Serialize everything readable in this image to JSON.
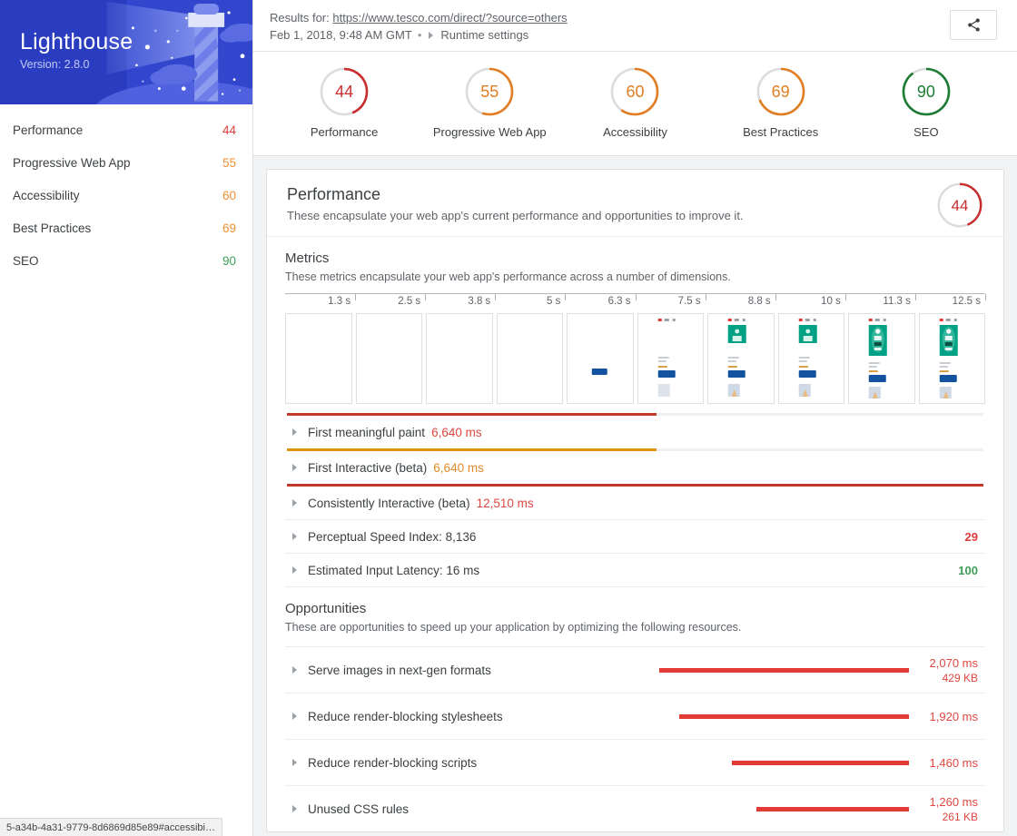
{
  "sidebar": {
    "app_title": "Lighthouse",
    "version_label": "Version: 2.8.0",
    "items": [
      {
        "label": "Performance",
        "score": "44",
        "color": "#df3c3c"
      },
      {
        "label": "Progressive Web App",
        "score": "55",
        "color": "#ef8f33"
      },
      {
        "label": "Accessibility",
        "score": "60",
        "color": "#ef8f33"
      },
      {
        "label": "Best Practices",
        "score": "69",
        "color": "#ef8f33"
      },
      {
        "label": "SEO",
        "score": "90",
        "color": "#3c9e58"
      }
    ]
  },
  "statusbar": {
    "text": "5-a34b-4a31-9779-8d6869d85e89#accessibi…"
  },
  "topbar": {
    "results_prefix": "Results for:",
    "url": "https://www.tesco.com/direct/?source=others",
    "timestamp": "Feb 1, 2018, 9:48 AM GMT",
    "separator": "•",
    "runtime_settings_label": "Runtime settings",
    "share_icon": "share-icon"
  },
  "gauges": [
    {
      "label": "Performance",
      "value": "44",
      "pct": 44,
      "color": "#c92e2e"
    },
    {
      "label": "Progressive Web App",
      "value": "55",
      "pct": 55,
      "color": "#e17d22"
    },
    {
      "label": "Accessibility",
      "value": "60",
      "pct": 60,
      "color": "#e17d22"
    },
    {
      "label": "Best Practices",
      "value": "69",
      "pct": 69,
      "color": "#e17d22"
    },
    {
      "label": "SEO",
      "value": "90",
      "pct": 90,
      "color": "#1d7c33"
    }
  ],
  "performance_card": {
    "title": "Performance",
    "description": "These encapsulate your web app's current performance and opportunities to improve it.",
    "score": "44",
    "score_pct": 44,
    "score_color": "#c92e2e"
  },
  "metrics_section": {
    "title": "Metrics",
    "description": "These metrics encapsulate your web app's performance across a number of dimensions.",
    "timeline_ticks": [
      "1.3 s",
      "2.5 s",
      "3.8 s",
      "5 s",
      "6.3 s",
      "7.5 s",
      "8.8 s",
      "10 s",
      "11.3 s",
      "12.5 s"
    ],
    "rows": [
      {
        "name": "First meaningful paint",
        "value": "6,640 ms",
        "value_color": "#df4741",
        "bar_pct": 53,
        "bar_color": "#c0392b",
        "score": ""
      },
      {
        "name": "First Interactive (beta)",
        "value": "6,640 ms",
        "value_color": "#e08c2a",
        "bar_pct": 53,
        "bar_color": "#e0930f",
        "score": ""
      },
      {
        "name": "Consistently Interactive (beta)",
        "value": "12,510 ms",
        "value_color": "#df4741",
        "bar_pct": 100,
        "bar_color": "#c0392b",
        "score": ""
      },
      {
        "name": "Perceptual Speed Index: 8,136",
        "value": "",
        "value_color": "",
        "bar_pct": 0,
        "bar_color": "",
        "score": "29",
        "score_color": "#df3c3c"
      },
      {
        "name": "Estimated Input Latency: 16 ms",
        "value": "",
        "value_color": "",
        "bar_pct": 0,
        "bar_color": "",
        "score": "100",
        "score_color": "#3c9e58"
      }
    ]
  },
  "opportunities_section": {
    "title": "Opportunities",
    "description": "These are opportunities to speed up your application by optimizing the following resources.",
    "rows": [
      {
        "name": "Serve images in next-gen formats",
        "ms": "2,070 ms",
        "kb": "429 KB",
        "bar_width_pct": 100
      },
      {
        "name": "Reduce render-blocking stylesheets",
        "ms": "1,920 ms",
        "kb": "",
        "bar_width_pct": 92
      },
      {
        "name": "Reduce render-blocking scripts",
        "ms": "1,460 ms",
        "kb": "",
        "bar_width_pct": 71
      },
      {
        "name": "Unused CSS rules",
        "ms": "1,260 ms",
        "kb": "261 KB",
        "bar_width_pct": 61
      }
    ]
  },
  "filmstrip": {
    "frames": [
      {
        "stage": 0
      },
      {
        "stage": 0
      },
      {
        "stage": 0
      },
      {
        "stage": 0
      },
      {
        "stage": 1
      },
      {
        "stage": 2
      },
      {
        "stage": 3
      },
      {
        "stage": 3
      },
      {
        "stage": 4
      },
      {
        "stage": 4
      }
    ]
  },
  "chart_data": {
    "type": "bar",
    "title": "Lighthouse Performance Metrics and Opportunities",
    "categories": [
      "First meaningful paint",
      "First Interactive (beta)",
      "Consistently Interactive (beta)",
      "Perceptual Speed Index",
      "Estimated Input Latency",
      "Serve images in next-gen formats",
      "Reduce render-blocking stylesheets",
      "Reduce render-blocking scripts",
      "Unused CSS rules"
    ],
    "values": [
      6640,
      6640,
      12510,
      8136,
      16,
      2070,
      1920,
      1460,
      1260
    ],
    "xlabel": "",
    "ylabel": "milliseconds",
    "timeline_axis": [
      1.3,
      2.5,
      3.8,
      5,
      6.3,
      7.5,
      8.8,
      10,
      11.3,
      12.5
    ],
    "category_scores": {
      "Performance": 44,
      "Progressive Web App": 55,
      "Accessibility": 60,
      "Best Practices": 69,
      "SEO": 90
    }
  }
}
